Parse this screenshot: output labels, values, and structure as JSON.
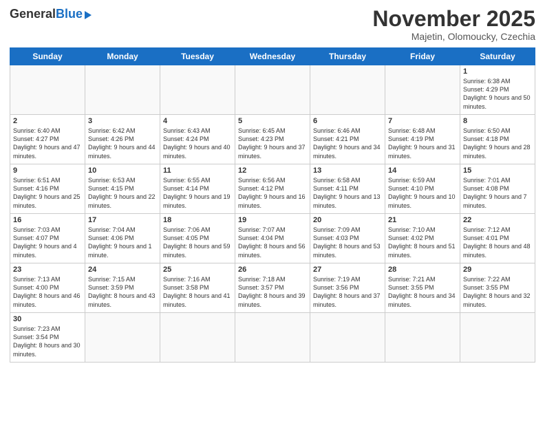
{
  "logo": {
    "general": "General",
    "blue": "Blue"
  },
  "title": "November 2025",
  "location": "Majetin, Olomoucky, Czechia",
  "days_header": [
    "Sunday",
    "Monday",
    "Tuesday",
    "Wednesday",
    "Thursday",
    "Friday",
    "Saturday"
  ],
  "weeks": [
    [
      {
        "day": "",
        "info": ""
      },
      {
        "day": "",
        "info": ""
      },
      {
        "day": "",
        "info": ""
      },
      {
        "day": "",
        "info": ""
      },
      {
        "day": "",
        "info": ""
      },
      {
        "day": "",
        "info": ""
      },
      {
        "day": "1",
        "info": "Sunrise: 6:38 AM\nSunset: 4:29 PM\nDaylight: 9 hours and 50 minutes."
      }
    ],
    [
      {
        "day": "2",
        "info": "Sunrise: 6:40 AM\nSunset: 4:27 PM\nDaylight: 9 hours and 47 minutes."
      },
      {
        "day": "3",
        "info": "Sunrise: 6:42 AM\nSunset: 4:26 PM\nDaylight: 9 hours and 44 minutes."
      },
      {
        "day": "4",
        "info": "Sunrise: 6:43 AM\nSunset: 4:24 PM\nDaylight: 9 hours and 40 minutes."
      },
      {
        "day": "5",
        "info": "Sunrise: 6:45 AM\nSunset: 4:23 PM\nDaylight: 9 hours and 37 minutes."
      },
      {
        "day": "6",
        "info": "Sunrise: 6:46 AM\nSunset: 4:21 PM\nDaylight: 9 hours and 34 minutes."
      },
      {
        "day": "7",
        "info": "Sunrise: 6:48 AM\nSunset: 4:19 PM\nDaylight: 9 hours and 31 minutes."
      },
      {
        "day": "8",
        "info": "Sunrise: 6:50 AM\nSunset: 4:18 PM\nDaylight: 9 hours and 28 minutes."
      }
    ],
    [
      {
        "day": "9",
        "info": "Sunrise: 6:51 AM\nSunset: 4:16 PM\nDaylight: 9 hours and 25 minutes."
      },
      {
        "day": "10",
        "info": "Sunrise: 6:53 AM\nSunset: 4:15 PM\nDaylight: 9 hours and 22 minutes."
      },
      {
        "day": "11",
        "info": "Sunrise: 6:55 AM\nSunset: 4:14 PM\nDaylight: 9 hours and 19 minutes."
      },
      {
        "day": "12",
        "info": "Sunrise: 6:56 AM\nSunset: 4:12 PM\nDaylight: 9 hours and 16 minutes."
      },
      {
        "day": "13",
        "info": "Sunrise: 6:58 AM\nSunset: 4:11 PM\nDaylight: 9 hours and 13 minutes."
      },
      {
        "day": "14",
        "info": "Sunrise: 6:59 AM\nSunset: 4:10 PM\nDaylight: 9 hours and 10 minutes."
      },
      {
        "day": "15",
        "info": "Sunrise: 7:01 AM\nSunset: 4:08 PM\nDaylight: 9 hours and 7 minutes."
      }
    ],
    [
      {
        "day": "16",
        "info": "Sunrise: 7:03 AM\nSunset: 4:07 PM\nDaylight: 9 hours and 4 minutes."
      },
      {
        "day": "17",
        "info": "Sunrise: 7:04 AM\nSunset: 4:06 PM\nDaylight: 9 hours and 1 minute."
      },
      {
        "day": "18",
        "info": "Sunrise: 7:06 AM\nSunset: 4:05 PM\nDaylight: 8 hours and 59 minutes."
      },
      {
        "day": "19",
        "info": "Sunrise: 7:07 AM\nSunset: 4:04 PM\nDaylight: 8 hours and 56 minutes."
      },
      {
        "day": "20",
        "info": "Sunrise: 7:09 AM\nSunset: 4:03 PM\nDaylight: 8 hours and 53 minutes."
      },
      {
        "day": "21",
        "info": "Sunrise: 7:10 AM\nSunset: 4:02 PM\nDaylight: 8 hours and 51 minutes."
      },
      {
        "day": "22",
        "info": "Sunrise: 7:12 AM\nSunset: 4:01 PM\nDaylight: 8 hours and 48 minutes."
      }
    ],
    [
      {
        "day": "23",
        "info": "Sunrise: 7:13 AM\nSunset: 4:00 PM\nDaylight: 8 hours and 46 minutes."
      },
      {
        "day": "24",
        "info": "Sunrise: 7:15 AM\nSunset: 3:59 PM\nDaylight: 8 hours and 43 minutes."
      },
      {
        "day": "25",
        "info": "Sunrise: 7:16 AM\nSunset: 3:58 PM\nDaylight: 8 hours and 41 minutes."
      },
      {
        "day": "26",
        "info": "Sunrise: 7:18 AM\nSunset: 3:57 PM\nDaylight: 8 hours and 39 minutes."
      },
      {
        "day": "27",
        "info": "Sunrise: 7:19 AM\nSunset: 3:56 PM\nDaylight: 8 hours and 37 minutes."
      },
      {
        "day": "28",
        "info": "Sunrise: 7:21 AM\nSunset: 3:55 PM\nDaylight: 8 hours and 34 minutes."
      },
      {
        "day": "29",
        "info": "Sunrise: 7:22 AM\nSunset: 3:55 PM\nDaylight: 8 hours and 32 minutes."
      }
    ],
    [
      {
        "day": "30",
        "info": "Sunrise: 7:23 AM\nSunset: 3:54 PM\nDaylight: 8 hours and 30 minutes."
      },
      {
        "day": "",
        "info": ""
      },
      {
        "day": "",
        "info": ""
      },
      {
        "day": "",
        "info": ""
      },
      {
        "day": "",
        "info": ""
      },
      {
        "day": "",
        "info": ""
      },
      {
        "day": "",
        "info": ""
      }
    ]
  ]
}
